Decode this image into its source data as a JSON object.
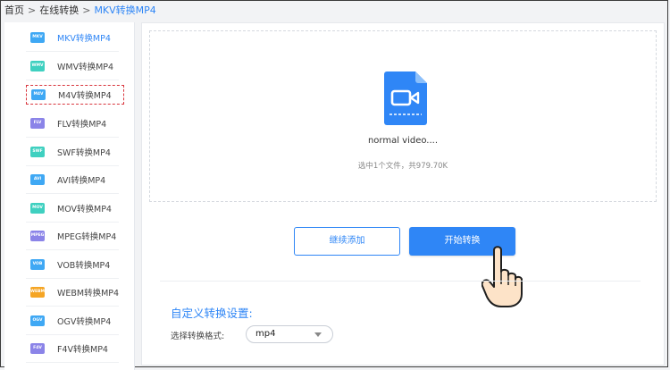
{
  "breadcrumb": {
    "home": "首页",
    "separator1": ">",
    "section": "在线转换",
    "separator2": ">",
    "current": "MKV转换MP4"
  },
  "sidebar": {
    "items": [
      {
        "badge": "MKV",
        "label": "MKV转换MP4",
        "color": "#3fa8f4",
        "active": true
      },
      {
        "badge": "WMV",
        "label": "WMV转换MP4",
        "color": "#3fd0c0",
        "active": false
      },
      {
        "badge": "M4V",
        "label": "M4V转换MP4",
        "color": "#3fa8f4",
        "active": false,
        "highlighted": true
      },
      {
        "badge": "FLV",
        "label": "FLV转换MP4",
        "color": "#8b84e8",
        "active": false
      },
      {
        "badge": "SWF",
        "label": "SWF转换MP4",
        "color": "#3fd0c0",
        "active": false
      },
      {
        "badge": "AVI",
        "label": "AVI转换MP4",
        "color": "#3fa8f4",
        "active": false
      },
      {
        "badge": "MOV",
        "label": "MOV转换MP4",
        "color": "#3fd0c0",
        "active": false
      },
      {
        "badge": "MPEG",
        "label": "MPEG转换MP4",
        "color": "#8b84e8",
        "active": false
      },
      {
        "badge": "VOB",
        "label": "VOB转换MP4",
        "color": "#3fa8f4",
        "active": false
      },
      {
        "badge": "WEBM",
        "label": "WEBM转换MP4",
        "color": "#f5a524",
        "active": false
      },
      {
        "badge": "OGV",
        "label": "OGV转换MP4",
        "color": "#3fa8f4",
        "active": false
      },
      {
        "badge": "F4V",
        "label": "F4V转换MP4",
        "color": "#8b84e8",
        "active": false
      }
    ]
  },
  "upload": {
    "file_name": "normal video....",
    "file_info": "选中1个文件，共979.70K",
    "file_icon": "video-file-icon"
  },
  "actions": {
    "continue_label": "继续添加",
    "start_label": "开始转换"
  },
  "settings": {
    "title": "自定义转换设置:",
    "format_label": "选择转换格式:",
    "format_value": "mp4"
  },
  "colors": {
    "accent": "#2f86f6",
    "highlight_border": "#d9363e"
  }
}
